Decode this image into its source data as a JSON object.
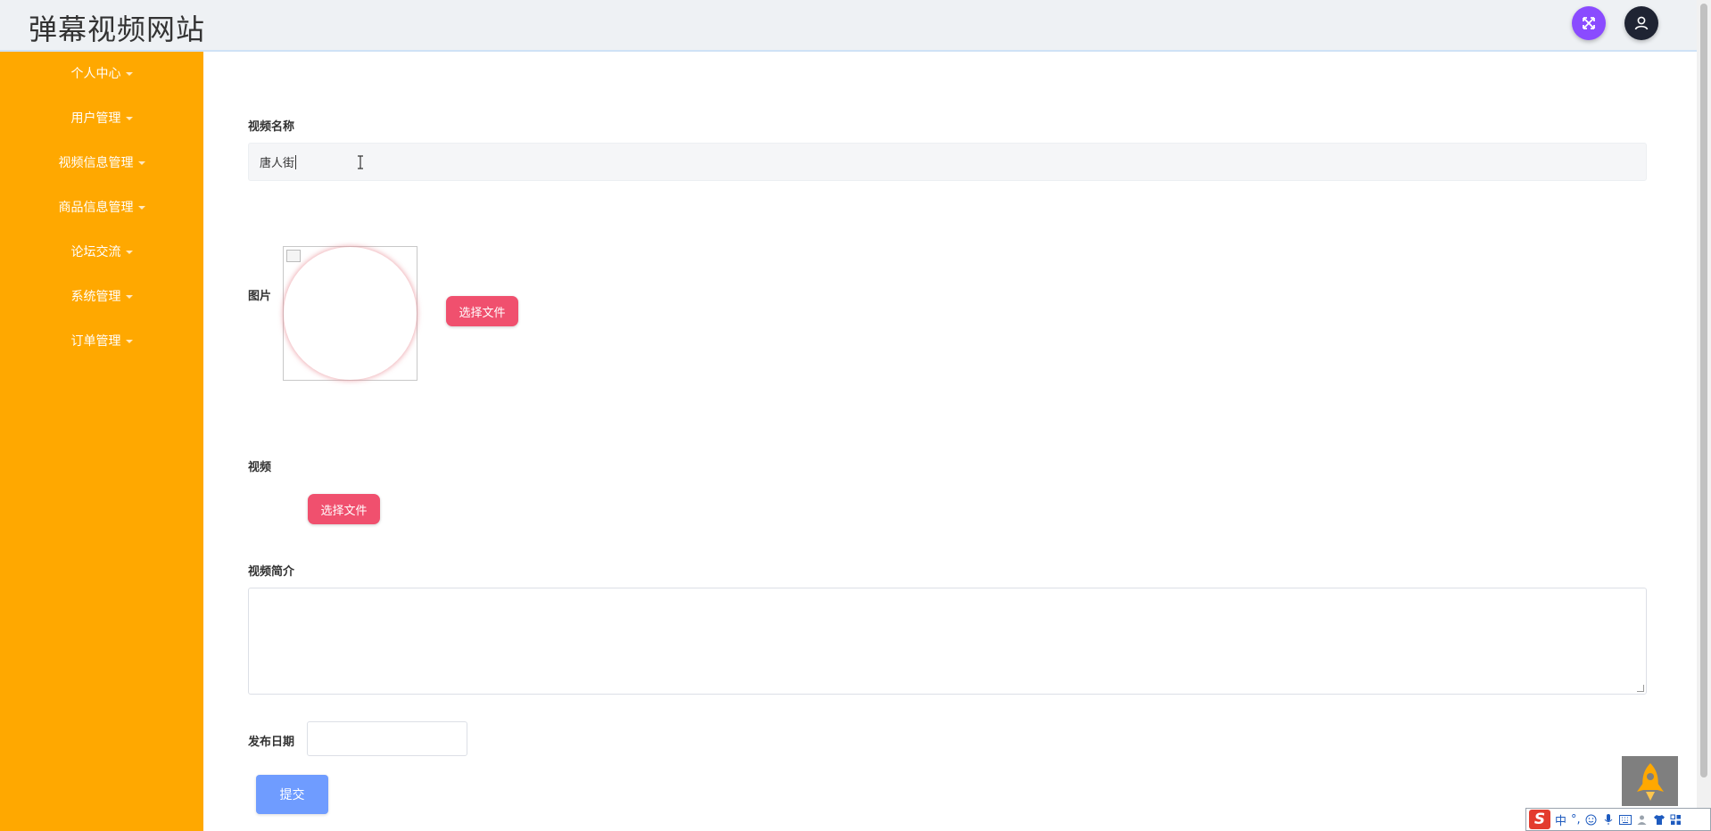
{
  "app": {
    "title": "弹幕视频网站"
  },
  "header": {
    "fullscreen_icon": "expand-arrows-icon",
    "user_icon": "user-icon"
  },
  "sidebar": {
    "items": [
      {
        "label": "个人中心"
      },
      {
        "label": "用户管理"
      },
      {
        "label": "视频信息管理"
      },
      {
        "label": "商品信息管理"
      },
      {
        "label": "论坛交流"
      },
      {
        "label": "系统管理"
      },
      {
        "label": "订单管理"
      }
    ]
  },
  "form": {
    "video_name_label": "视频名称",
    "video_name_value": "唐人街",
    "image_label": "图片",
    "image_upload_button": "选择文件",
    "video_label": "视频",
    "video_upload_button": "选择文件",
    "intro_label": "视频简介",
    "intro_value": "",
    "date_label": "发布日期",
    "date_value": "",
    "submit_button": "提交"
  },
  "ime": {
    "logo": "S",
    "mode": "中",
    "punct": "°,"
  },
  "colors": {
    "sidebar": "#ffa800",
    "header": "#eef1f4",
    "upload_button": "#f0506e",
    "submit_button": "#6f9cff",
    "fullscreen_button": "#8a4bff",
    "user_button": "#1f2433"
  }
}
